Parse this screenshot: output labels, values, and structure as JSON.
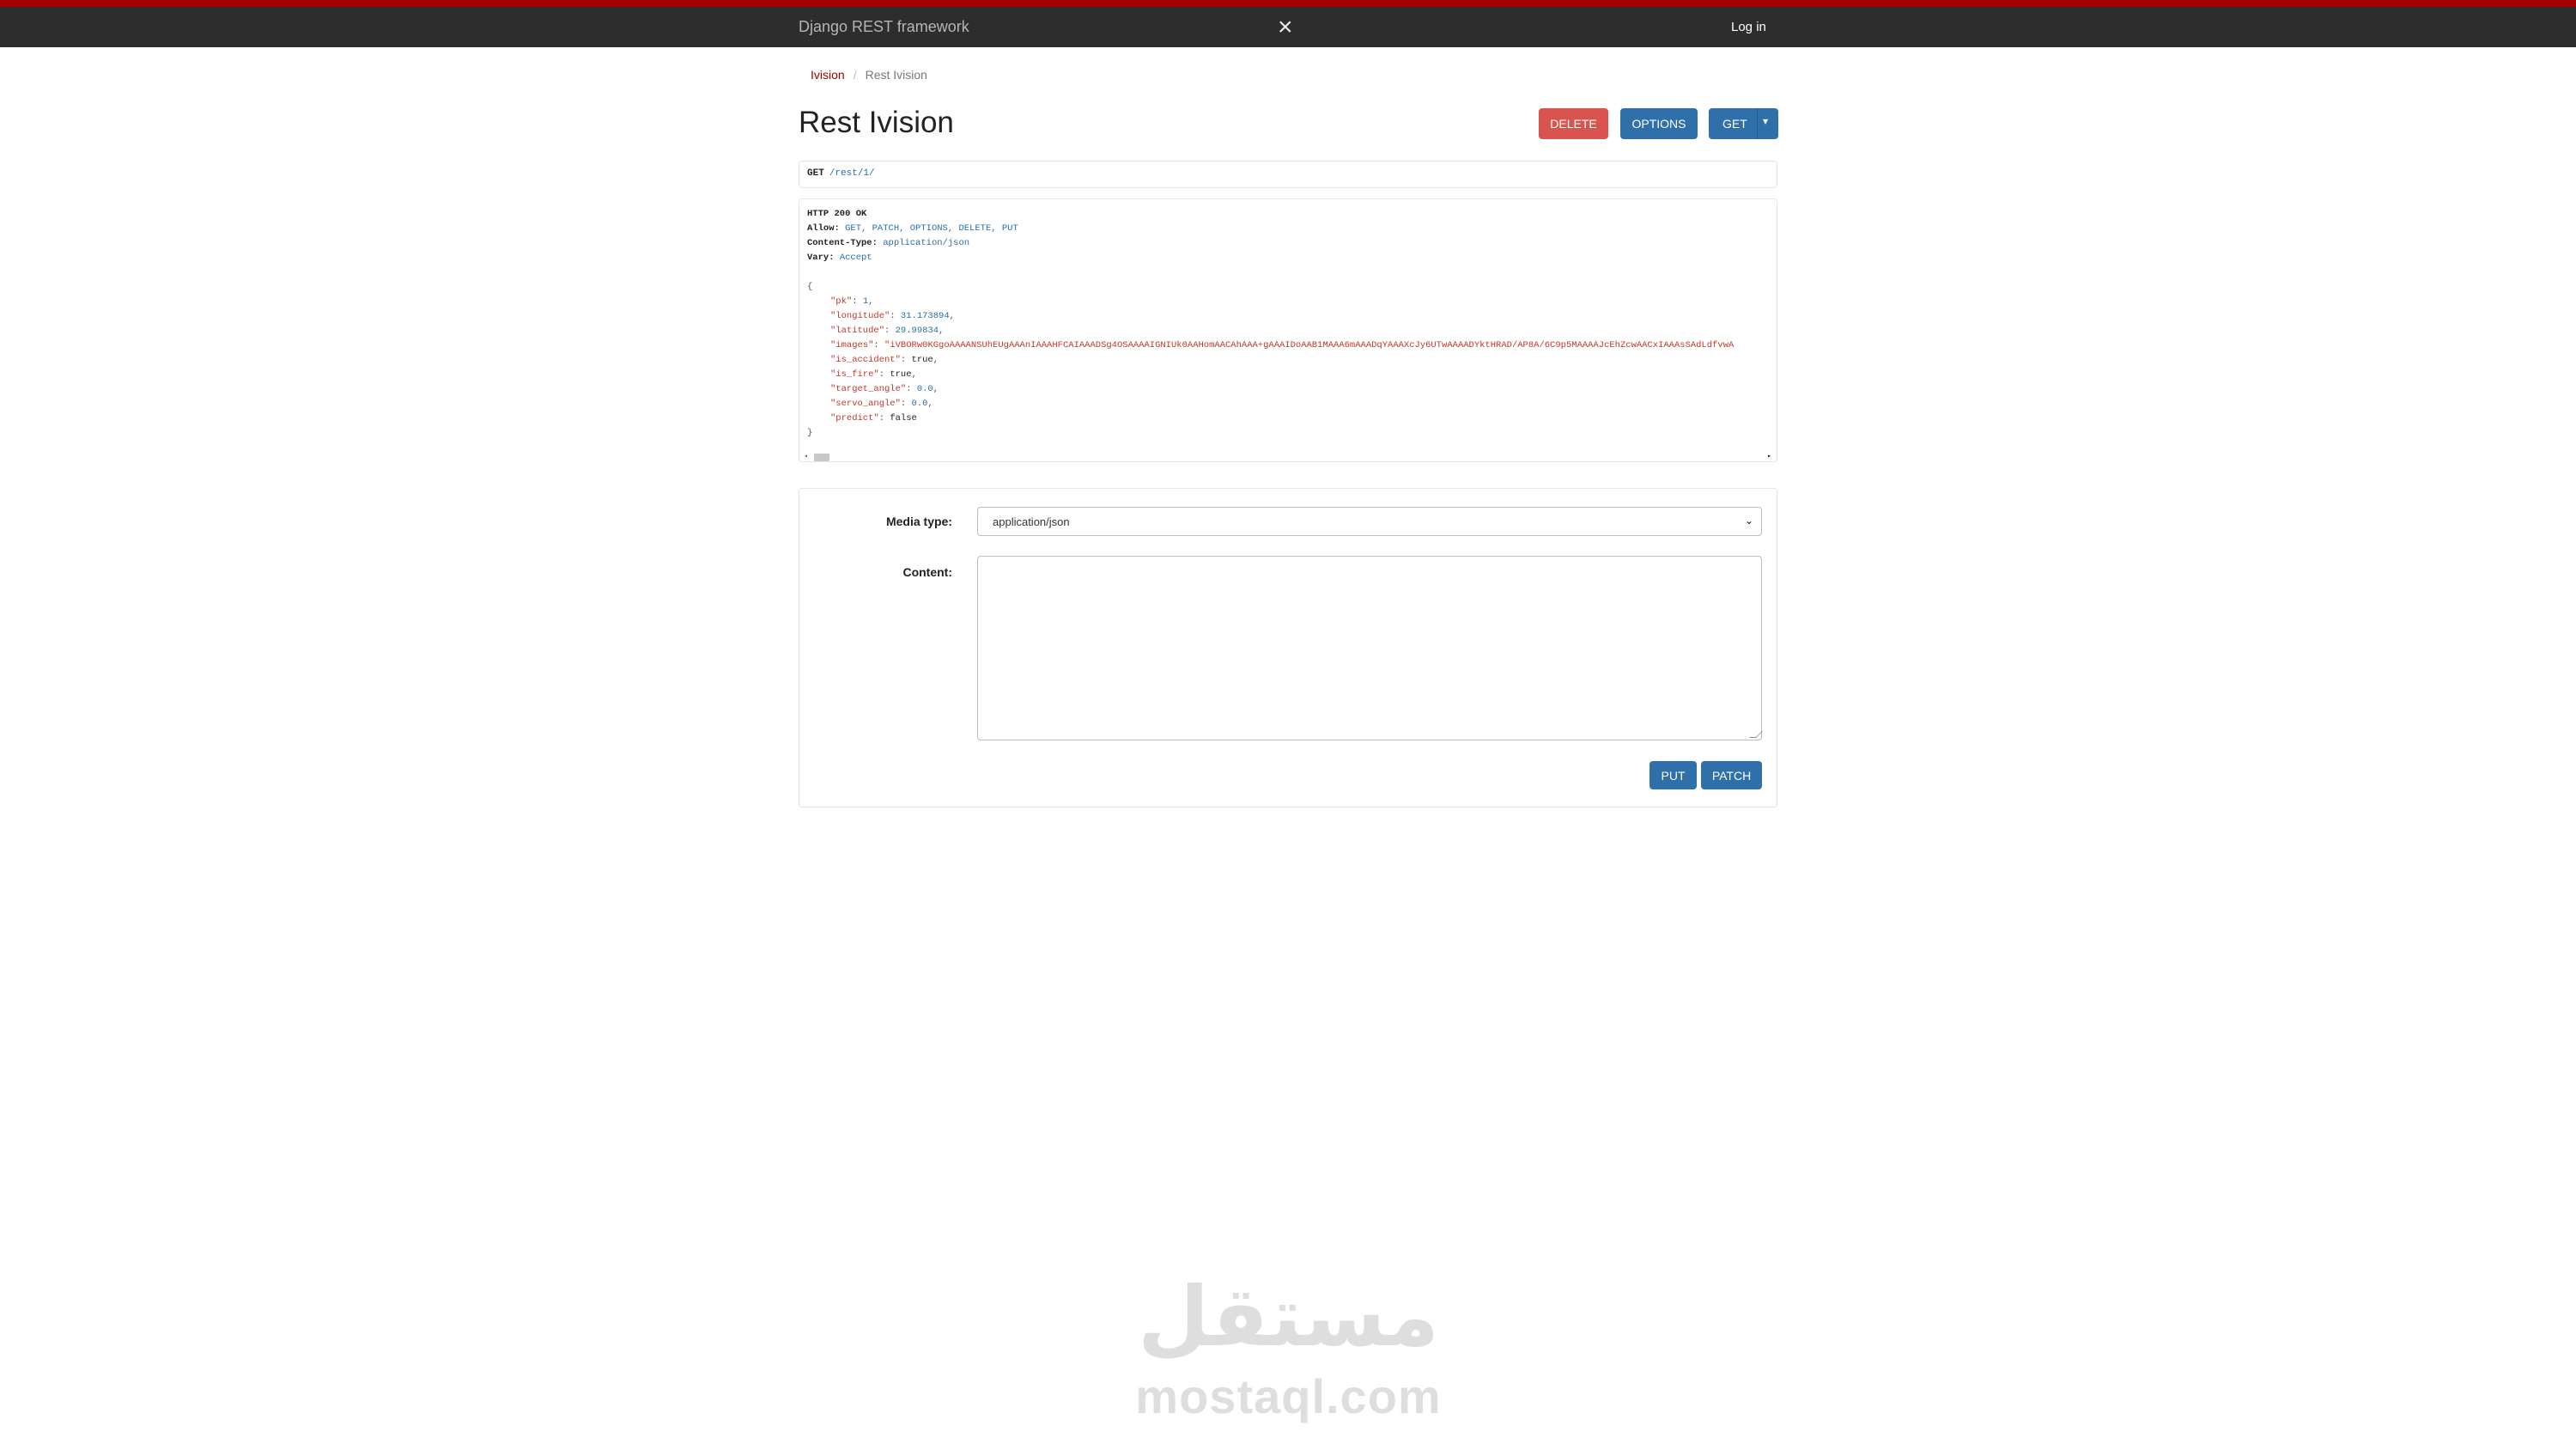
{
  "navbar": {
    "brand": "Django REST framework",
    "close_glyph": "×",
    "login_label": "Log in"
  },
  "breadcrumb": {
    "items": [
      "Ivision",
      "Rest Ivision"
    ],
    "separator": "/"
  },
  "page": {
    "title": "Rest Ivision"
  },
  "toolbar": {
    "delete_label": "DELETE",
    "options_label": "OPTIONS",
    "get_label": "GET"
  },
  "request": {
    "method": "GET",
    "path": "/rest/1/"
  },
  "response": {
    "status": "HTTP 200 OK",
    "headers": [
      {
        "key": "Allow:",
        "value": "GET, PATCH, OPTIONS, DELETE, PUT"
      },
      {
        "key": "Content-Type:",
        "value": "application/json"
      },
      {
        "key": "Vary:",
        "value": "Accept"
      }
    ],
    "open_brace": "{",
    "close_brace": "}",
    "fields": [
      {
        "key": "\"pk\"",
        "value": "1",
        "type": "num"
      },
      {
        "key": "\"longitude\"",
        "value": "31.173894",
        "type": "num"
      },
      {
        "key": "\"latitude\"",
        "value": "29.99834",
        "type": "num"
      },
      {
        "key": "\"images\"",
        "value": "\"iVBORw0KGgoAAAANSUhEUgAAAnIAAAHFCAIAAADSg4OSAAAAIGNIUk0AAHomAACAhAAA+gAAAIDoAAB1MAAA6mAAADqYAAAXcJy6UTwAAAADYktHRAD/AP8A/6C9p5MAAAAJcEhZcwAACxIAAAsSAdLdfvwA",
        "type": "str"
      },
      {
        "key": "\"is_accident\"",
        "value": "true",
        "type": "bool"
      },
      {
        "key": "\"is_fire\"",
        "value": "true",
        "type": "bool"
      },
      {
        "key": "\"target_angle\"",
        "value": "0.0",
        "type": "num"
      },
      {
        "key": "\"servo_angle\"",
        "value": "0.0",
        "type": "num"
      },
      {
        "key": "\"predict\"",
        "value": "false",
        "type": "bool"
      }
    ],
    "scroll": {
      "arrow_left": "◂",
      "arrow_right": "▸"
    }
  },
  "form": {
    "media_type_label": "Media type:",
    "media_type_value": "application/json",
    "content_label": "Content:",
    "content_value": "",
    "put_label": "PUT",
    "patch_label": "PATCH"
  },
  "watermark": {
    "arabic": "مستقل",
    "latin": "mostaql.com"
  },
  "colors": {
    "accent_red": "#a30000",
    "primary_blue": "#2f6faa",
    "danger": "#d9534f",
    "navbar_bg": "#2d2d2d"
  },
  "icons": {
    "close": "close-icon",
    "dropdown": "caret-down-icon"
  }
}
